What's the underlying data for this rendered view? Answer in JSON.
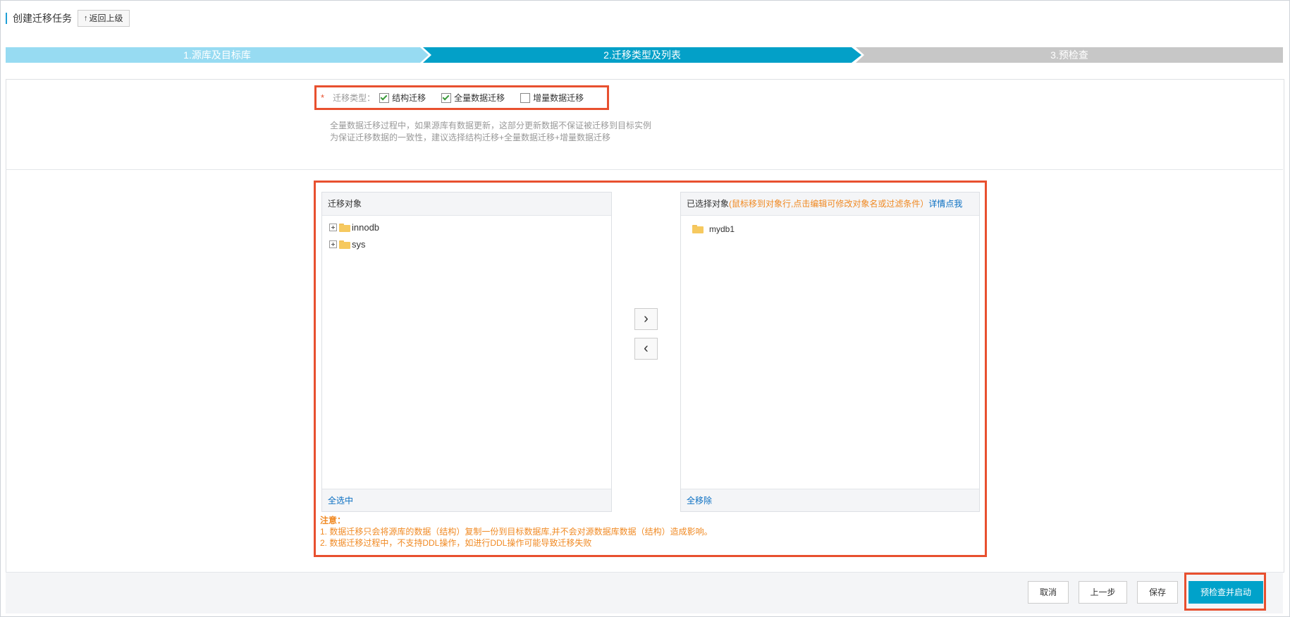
{
  "header": {
    "title": "创建迁移任务",
    "back_label": "返回上级"
  },
  "steps": [
    {
      "label": "1.源库及目标库",
      "color": "#97dbf2"
    },
    {
      "label": "2.迁移类型及列表",
      "color": "#03a0c8"
    },
    {
      "label": "3.预检查",
      "color": "#c7c7c7"
    }
  ],
  "migration_type": {
    "required_mark": "*",
    "label": "迁移类型：",
    "options": [
      {
        "label": "结构迁移",
        "checked": true
      },
      {
        "label": "全量数据迁移",
        "checked": true
      },
      {
        "label": "增量数据迁移",
        "checked": false
      }
    ],
    "description": [
      "全量数据迁移过程中，如果源库有数据更新，这部分更新数据不保证被迁移到目标实例",
      "为保证迁移数据的一致性，建议选择结构迁移+全量数据迁移+增量数据迁移"
    ]
  },
  "source_list": {
    "title": "迁移对象",
    "items": [
      "innodb",
      "sys"
    ],
    "footer": "全选中"
  },
  "selected_list": {
    "title": "已选择对象",
    "hint": "(鼠标移到对象行,点击编辑可修改对象名或过滤条件）",
    "more_link": "详情点我",
    "items": [
      "mydb1"
    ],
    "footer": "全移除"
  },
  "transfer": {
    "add_icon": "chevron-right",
    "remove_icon": "chevron-left",
    "add_glyph": "›",
    "remove_glyph": "‹"
  },
  "notes": {
    "title": "注意：",
    "lines": [
      "1. 数据迁移只会将源库的数据（结构）复制一份到目标数据库,并不会对源数据库数据（结构）造成影响。",
      "2. 数据迁移过程中，不支持DDL操作，如进行DDL操作可能导致迁移失败"
    ]
  },
  "footer": {
    "cancel": "取消",
    "prev": "上一步",
    "save": "保存",
    "start": "预检查并启动"
  },
  "colors": {
    "accent": "#00a2ca",
    "highlight": "#e8502f",
    "hint": "#f08a24",
    "link": "#0a6fc2"
  }
}
